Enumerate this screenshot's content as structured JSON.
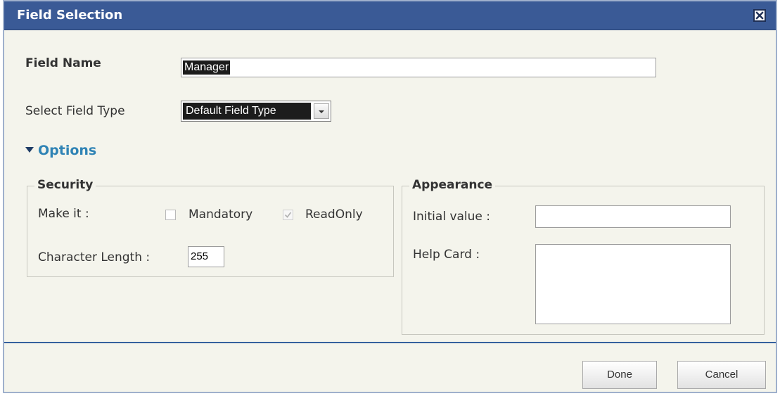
{
  "dialog": {
    "title": "Field Selection"
  },
  "field_name": {
    "label": "Field Name",
    "value": "Manager"
  },
  "field_type": {
    "label": "Select Field Type",
    "selected": "Default Field Type"
  },
  "options": {
    "label": "Options",
    "expanded": true
  },
  "security": {
    "legend": "Security",
    "make_it_label": "Make it :",
    "mandatory": {
      "label": "Mandatory",
      "checked": false
    },
    "readonly": {
      "label": "ReadOnly",
      "checked": true,
      "disabled": true
    },
    "char_length_label": "Character Length :",
    "char_length_value": "255"
  },
  "appearance": {
    "legend": "Appearance",
    "initial_value_label": "Initial value :",
    "initial_value": "",
    "help_card_label": "Help Card :",
    "help_card_value": ""
  },
  "footer": {
    "done_label": "Done",
    "cancel_label": "Cancel"
  },
  "colors": {
    "titlebar": "#3a5a96",
    "panel": "#f4f4ec",
    "options_link": "#2f83b5",
    "footer_rule": "#35609e"
  }
}
